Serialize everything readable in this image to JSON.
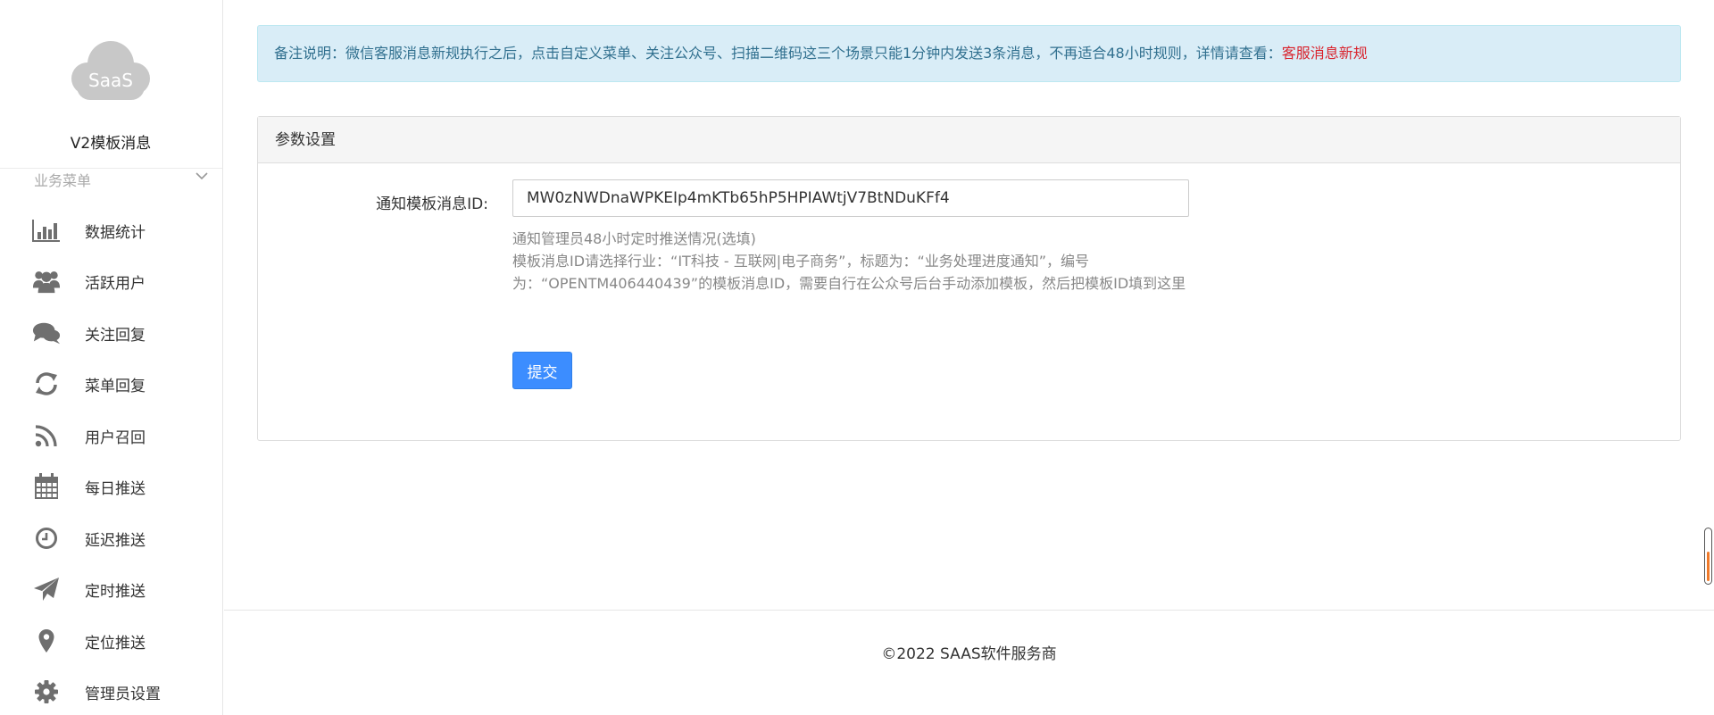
{
  "sidebar": {
    "logo_text": "SaaS",
    "app_title": "V2模板消息",
    "menu_header": "业务菜单",
    "items": [
      {
        "label": "数据统计",
        "icon": "bar-chart-icon"
      },
      {
        "label": "活跃用户",
        "icon": "users-icon"
      },
      {
        "label": "关注回复",
        "icon": "comments-icon"
      },
      {
        "label": "菜单回复",
        "icon": "refresh-icon"
      },
      {
        "label": "用户召回",
        "icon": "rss-icon"
      },
      {
        "label": "每日推送",
        "icon": "calendar-icon"
      },
      {
        "label": "延迟推送",
        "icon": "clock-icon"
      },
      {
        "label": "定时推送",
        "icon": "paper-plane-icon"
      },
      {
        "label": "定位推送",
        "icon": "map-marker-icon"
      },
      {
        "label": "管理员设置",
        "icon": "gear-icon"
      }
    ]
  },
  "notice": {
    "text": "备注说明：微信客服消息新规执行之后，点击自定义菜单、关注公众号、扫描二维码这三个场景只能1分钟内发送3条消息，不再适合48小时规则，详情请查看：",
    "link": "客服消息新规"
  },
  "panel": {
    "title": "参数设置",
    "field_label": "通知模板消息ID:",
    "field_value": "MW0zNWDnaWPKEIp4mKTb65hP5HPIAWtjV7BtNDuKFf4",
    "help_line1": "通知管理员48小时定时推送情况(选填)",
    "help_line2": "模板消息ID请选择行业：“IT科技 - 互联网|电子商务”，标题为：“业务处理进度通知”，编号为：“OPENTM406440439”的模板消息ID，需要自行在公众号后台手动添加模板，然后把模板ID填到这里",
    "submit_label": "提交"
  },
  "footer": {
    "copyright": "©2022 SAAS软件服务商"
  },
  "colors": {
    "notice_bg": "#d9edf7",
    "notice_text": "#31708f",
    "link_red": "#d9232d",
    "button_blue": "#3c8dff",
    "icon_gray": "#6f6f6f"
  }
}
